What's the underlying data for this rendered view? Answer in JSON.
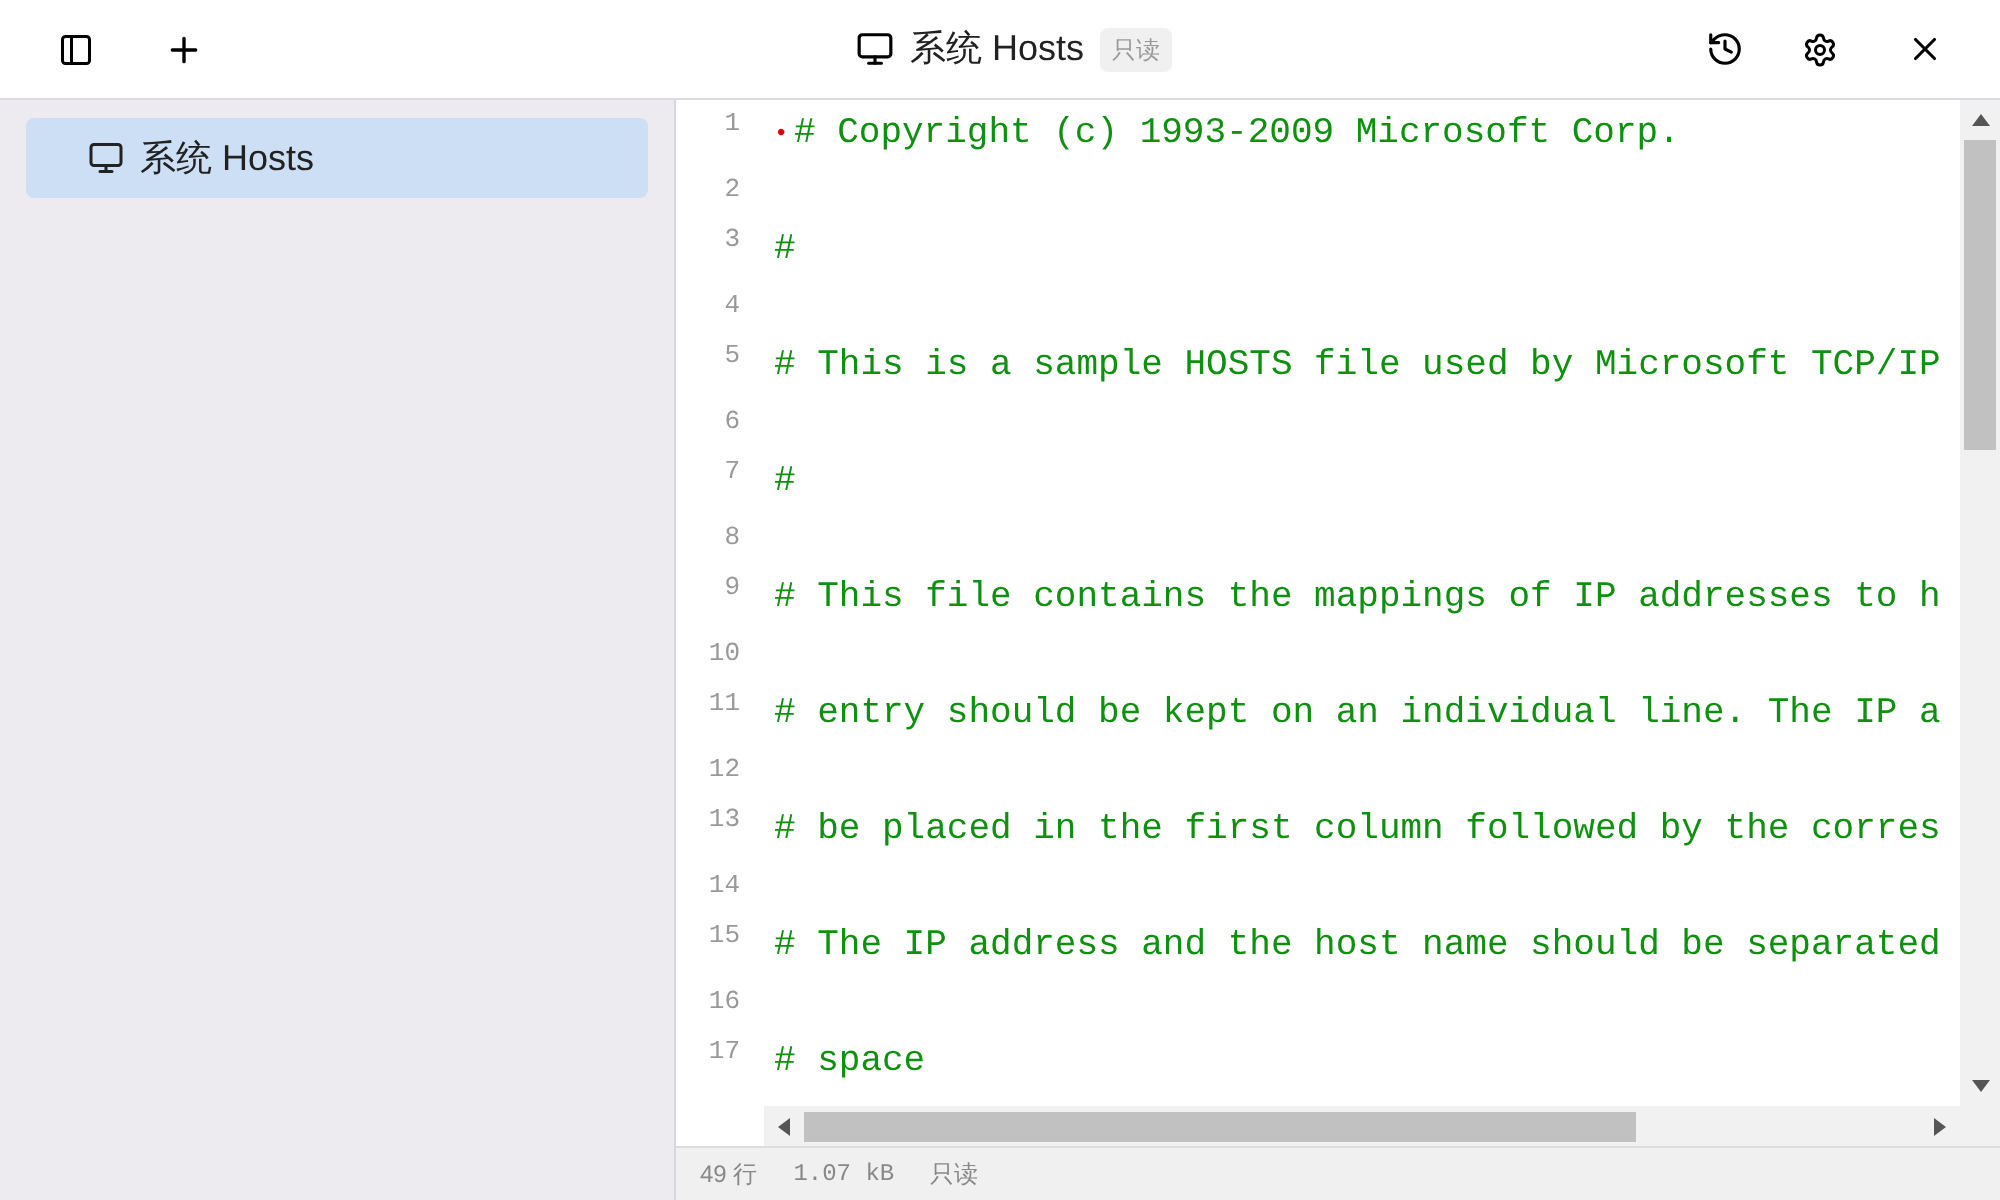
{
  "window": {
    "title": "系统 Hosts",
    "badge": "只读"
  },
  "sidebar": {
    "items": [
      {
        "label": "系统 Hosts",
        "selected": true
      }
    ]
  },
  "editor": {
    "lines": [
      {
        "number": "1",
        "text": "# Copyright (c) 1993-2009 Microsoft Corp.",
        "marker": "•"
      },
      {
        "number": "2"
      },
      {
        "number": "3",
        "text": "#"
      },
      {
        "number": "4"
      },
      {
        "number": "5",
        "text": "# This is a sample HOSTS file used by Microsoft TCP/IP"
      },
      {
        "number": "6"
      },
      {
        "number": "7",
        "text": "#"
      },
      {
        "number": "8"
      },
      {
        "number": "9",
        "text": "# This file contains the mappings of IP addresses to h"
      },
      {
        "number": "10"
      },
      {
        "number": "11",
        "text": "# entry should be kept on an individual line. The IP a"
      },
      {
        "number": "12"
      },
      {
        "number": "13",
        "text": "# be placed in the first column followed by the corres"
      },
      {
        "number": "14"
      },
      {
        "number": "15",
        "text": "# The IP address and the host name should be separated"
      },
      {
        "number": "16"
      },
      {
        "number": "17",
        "text": "# space"
      }
    ]
  },
  "status_bar": {
    "lines": "49 行",
    "size": "1.07 kB",
    "mode": "只读"
  }
}
